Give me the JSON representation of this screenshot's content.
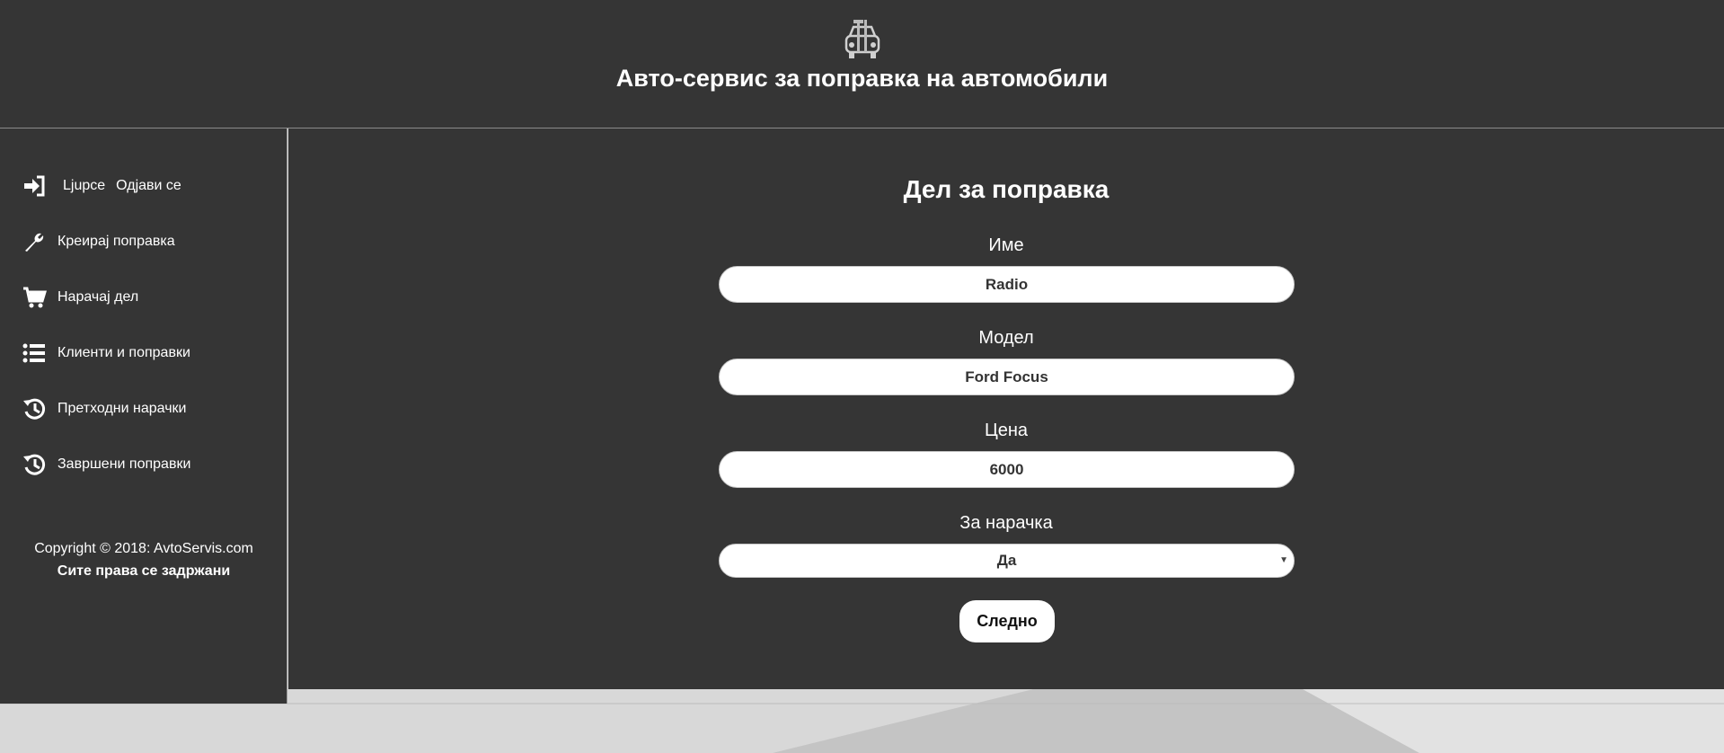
{
  "header": {
    "title": "Авто-сервис за поправка на автомобили",
    "logo_icon": "car-repair-icon"
  },
  "sidebar": {
    "user": {
      "icon": "sign-in-icon",
      "name": "Ljupce",
      "logout_label": "Одјави се"
    },
    "items": [
      {
        "icon": "wrench-icon",
        "label": "Креирај поправка"
      },
      {
        "icon": "cart-icon",
        "label": "Нарачај дел"
      },
      {
        "icon": "list-icon",
        "label": "Клиенти и поправки"
      },
      {
        "icon": "history-icon",
        "label": "Претходни нарачки"
      },
      {
        "icon": "history-icon",
        "label": "Завршени поправки"
      }
    ],
    "copyright": {
      "line1": "Copyright © 2018: AvtoServis.com",
      "line2": "Сите права се задржани"
    }
  },
  "form": {
    "title": "Дел за поправка",
    "fields": [
      {
        "label": "Име",
        "value": "Radio"
      },
      {
        "label": "Модел",
        "value": "Ford Focus"
      },
      {
        "label": "Цена",
        "value": "6000"
      }
    ],
    "order": {
      "label": "За нарачка",
      "selected": "Да"
    },
    "next_label": "Следно"
  },
  "colors": {
    "panel": "#353535",
    "page_background": "#d9d9d9",
    "text": "#ffffff",
    "field_background": "#ffffff"
  }
}
